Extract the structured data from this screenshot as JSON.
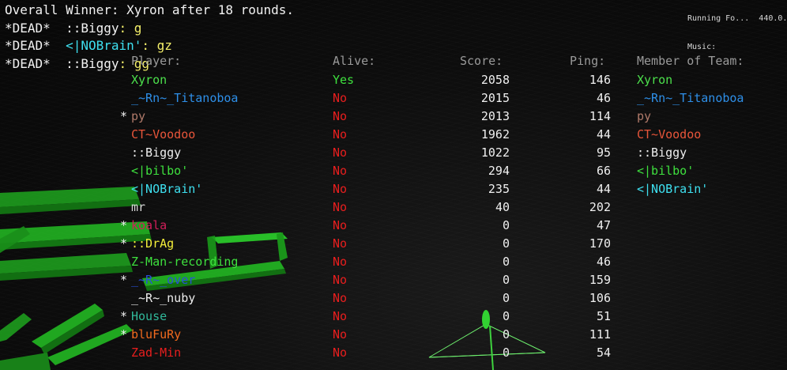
{
  "chat": [
    {
      "parts": [
        {
          "text": "Overall Winner: Xyron after 18 rounds.",
          "color": "#f2f2f2"
        }
      ]
    },
    {
      "parts": [
        {
          "text": "*DEAD*  ",
          "color": "#f2f2f2"
        },
        {
          "text": "::Biggy",
          "color": "#f2f2f2"
        },
        {
          "text": ": g",
          "color": "#f4ef6a"
        }
      ]
    },
    {
      "parts": [
        {
          "text": "*DEAD*  ",
          "color": "#f2f2f2"
        },
        {
          "text": "<|NOBrain'",
          "color": "#3ee0f0"
        },
        {
          "text": ": gz",
          "color": "#f4ef6a"
        }
      ]
    },
    {
      "parts": [
        {
          "text": "*DEAD*  ",
          "color": "#f2f2f2"
        },
        {
          "text": "::Biggy",
          "color": "#f2f2f2"
        },
        {
          "text": ": gg",
          "color": "#f4ef6a"
        }
      ]
    }
  ],
  "corner": {
    "line1": "Running Fo...  440.0...",
    "line2": "Music:"
  },
  "headers": {
    "player": "Player:",
    "alive": "Alive:",
    "score": "Score:",
    "ping": "Ping:",
    "team": "Member of Team:"
  },
  "players": [
    {
      "mark": "",
      "name": "Xyron",
      "name_color": "#4ce04c",
      "alive": "Yes",
      "alive_color": "#3ee03e",
      "score": "2058",
      "ping": "146",
      "team": "Xyron",
      "team_color": "#4ce04c"
    },
    {
      "mark": "",
      "name": "_~Rn~_Titanoboa",
      "name_color": "#2e8fe8",
      "alive": "No",
      "alive_color": "#e81e1e",
      "score": "2015",
      "ping": "46",
      "team": "_~Rn~_Titanoboa",
      "team_color": "#2e8fe8"
    },
    {
      "mark": "*",
      "name": "py",
      "name_color": "#b07a6a",
      "alive": "No",
      "alive_color": "#e81e1e",
      "score": "2013",
      "ping": "114",
      "team": "py",
      "team_color": "#b07a6a"
    },
    {
      "mark": "",
      "name": "CT~Voodoo",
      "name_color": "#e8553a",
      "alive": "No",
      "alive_color": "#e81e1e",
      "score": "1962",
      "ping": "44",
      "team": "CT~Voodoo",
      "team_color": "#e8553a"
    },
    {
      "mark": "",
      "name": "::Biggy",
      "name_color": "#eeeeee",
      "alive": "No",
      "alive_color": "#e81e1e",
      "score": "1022",
      "ping": "95",
      "team": "::Biggy",
      "team_color": "#eeeeee"
    },
    {
      "mark": "",
      "name": "<|bilbo'",
      "name_color": "#3ee03e",
      "alive": "No",
      "alive_color": "#e81e1e",
      "score": "294",
      "ping": "66",
      "team": "<|bilbo'",
      "team_color": "#3ee03e"
    },
    {
      "mark": "",
      "name": "<|NOBrain'",
      "name_color": "#3ee0f0",
      "alive": "No",
      "alive_color": "#e81e1e",
      "score": "235",
      "ping": "44",
      "team": "<|NOBrain'",
      "team_color": "#3ee0f0"
    },
    {
      "mark": "",
      "name": "mr",
      "name_color": "#d8d8d8",
      "alive": "No",
      "alive_color": "#e81e1e",
      "score": "40",
      "ping": "202",
      "team": "",
      "team_color": "#ffffff"
    },
    {
      "mark": "*",
      "name": "koala",
      "name_color": "#d01e5a",
      "alive": "No",
      "alive_color": "#e81e1e",
      "score": "0",
      "ping": "47",
      "team": "",
      "team_color": "#ffffff"
    },
    {
      "mark": "*",
      "name": "::DrAg",
      "name_color": "#f4ef3a",
      "alive": "No",
      "alive_color": "#e81e1e",
      "score": "0",
      "ping": "170",
      "team": "",
      "team_color": "#ffffff"
    },
    {
      "mark": "",
      "name": "Z-Man-recording",
      "name_color": "#3ee03e",
      "alive": "No",
      "alive_color": "#e81e1e",
      "score": "0",
      "ping": "46",
      "team": "",
      "team_color": "#ffffff"
    },
    {
      "mark": "*",
      "name": "_~R~_over",
      "name_color": "#2a50d8",
      "alive": "No",
      "alive_color": "#e81e1e",
      "score": "0",
      "ping": "159",
      "team": "",
      "team_color": "#ffffff"
    },
    {
      "mark": "",
      "name": "_~R~_nuby",
      "name_color": "#eeeeee",
      "alive": "No",
      "alive_color": "#e81e1e",
      "score": "0",
      "ping": "106",
      "team": "",
      "team_color": "#ffffff"
    },
    {
      "mark": "*",
      "name": "House",
      "name_color": "#30b89a",
      "alive": "No",
      "alive_color": "#e81e1e",
      "score": "0",
      "ping": "51",
      "team": "",
      "team_color": "#ffffff"
    },
    {
      "mark": "*",
      "name": "bluFuRy",
      "name_color": "#f06a1e",
      "alive": "No",
      "alive_color": "#e81e1e",
      "score": "0",
      "ping": "111",
      "team": "",
      "team_color": "#ffffff"
    },
    {
      "mark": "",
      "name": "Zad-Min",
      "name_color": "#e81e1e",
      "alive": "No",
      "alive_color": "#e81e1e",
      "score": "0",
      "ping": "54",
      "team": "",
      "team_color": "#ffffff"
    }
  ],
  "colors": {
    "wall": "#22c022",
    "header": "#9a9a9a",
    "background": "#0b0b0b"
  }
}
